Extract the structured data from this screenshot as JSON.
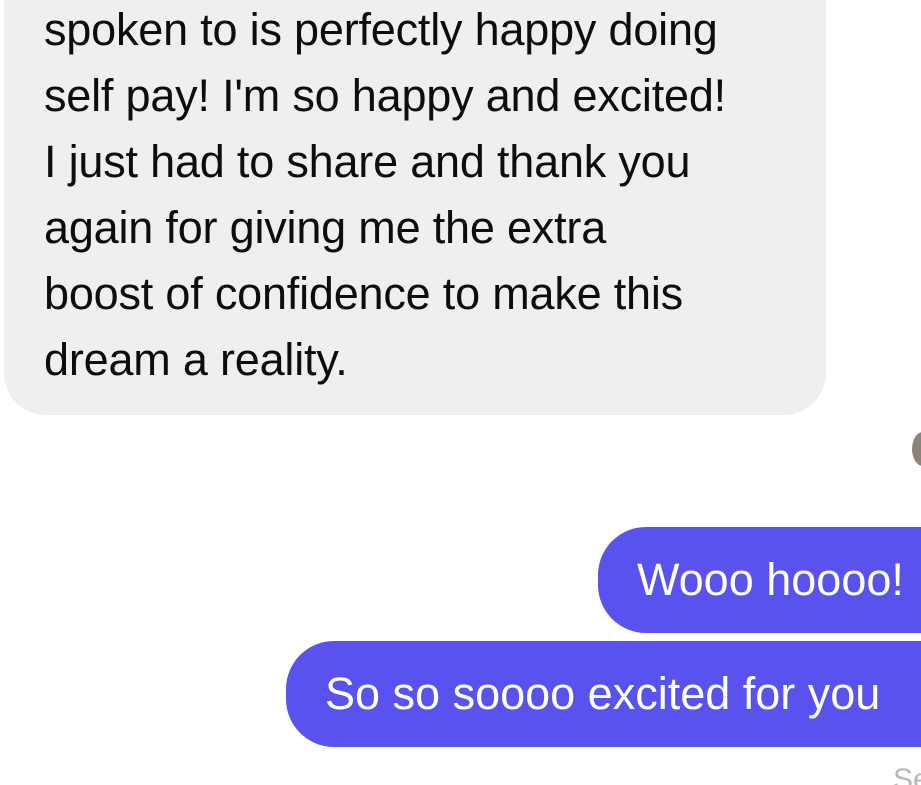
{
  "conversation": {
    "incoming_message": {
      "lines": [
        "spoken to is perfectly happy doing",
        "self pay! I'm so happy and excited!",
        "I just had to share and thank you",
        "again for giving me the extra",
        "boost of confidence to make this",
        "dream a reality."
      ]
    },
    "outgoing_messages": [
      {
        "text": "Wooo hoooo!"
      },
      {
        "text": "So so soooo excited for you"
      }
    ],
    "status_text": "Se"
  },
  "colors": {
    "incoming_bubble": "#efeff1",
    "outgoing_bubble": "#5a52ee",
    "incoming_text": "#0d0d0d",
    "outgoing_text": "#ffffff",
    "status_text": "#b9b9bd"
  }
}
